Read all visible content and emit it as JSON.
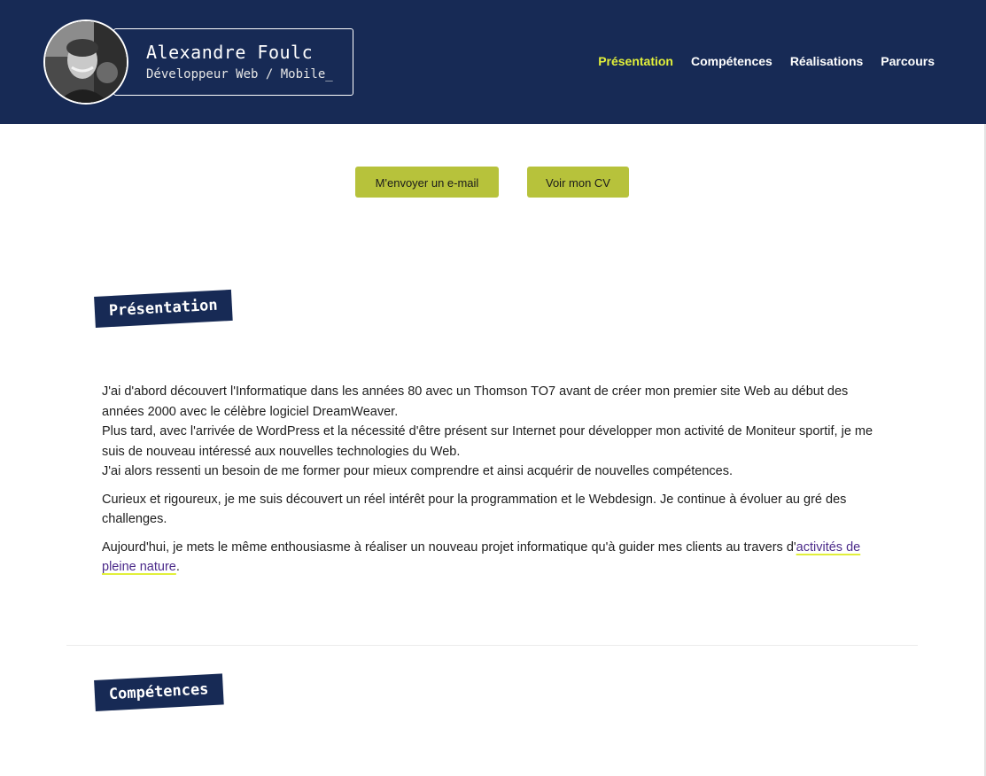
{
  "header": {
    "name": "Alexandre Foulc",
    "role": "Développeur Web / Mobile_",
    "background_color": "#172a55",
    "nav": [
      {
        "label": "Présentation",
        "active": true
      },
      {
        "label": "Compétences",
        "active": false
      },
      {
        "label": "Réalisations",
        "active": false
      },
      {
        "label": "Parcours",
        "active": false
      }
    ],
    "active_color": "#e1ef3a"
  },
  "buttons": {
    "email_label": "M'envoyer un e-mail",
    "cv_label": "Voir mon CV",
    "color": "#b7c23b"
  },
  "sections": {
    "presentation_title": "Présentation",
    "competences_title": "Compétences"
  },
  "presentation": {
    "p1_line1": "J'ai d'abord découvert l'Informatique dans les années 80 avec un Thomson TO7 avant de créer mon premier site Web au début des années 2000 avec le célèbre logiciel DreamWeaver.",
    "p1_line2": "Plus tard, avec l'arrivée de WordPress et la nécessité d'être présent sur Internet pour développer mon activité de Moniteur sportif, je me suis de nouveau intéressé aux nouvelles technologies du Web.",
    "p1_line3": "J'ai alors ressenti un besoin de me former pour mieux comprendre et ainsi acquérir de nouvelles compétences.",
    "p2": "Curieux et rigoureux, je me suis découvert un réel intérêt pour la programmation et le Webdesign. Je continue à évoluer au gré des challenges.",
    "p3_before": "Aujourd'hui, je mets le même enthousiasme à réaliser un nouveau projet informatique qu'à guider mes clients au travers d'",
    "p3_link": "activités de pleine nature",
    "p3_after": "."
  }
}
